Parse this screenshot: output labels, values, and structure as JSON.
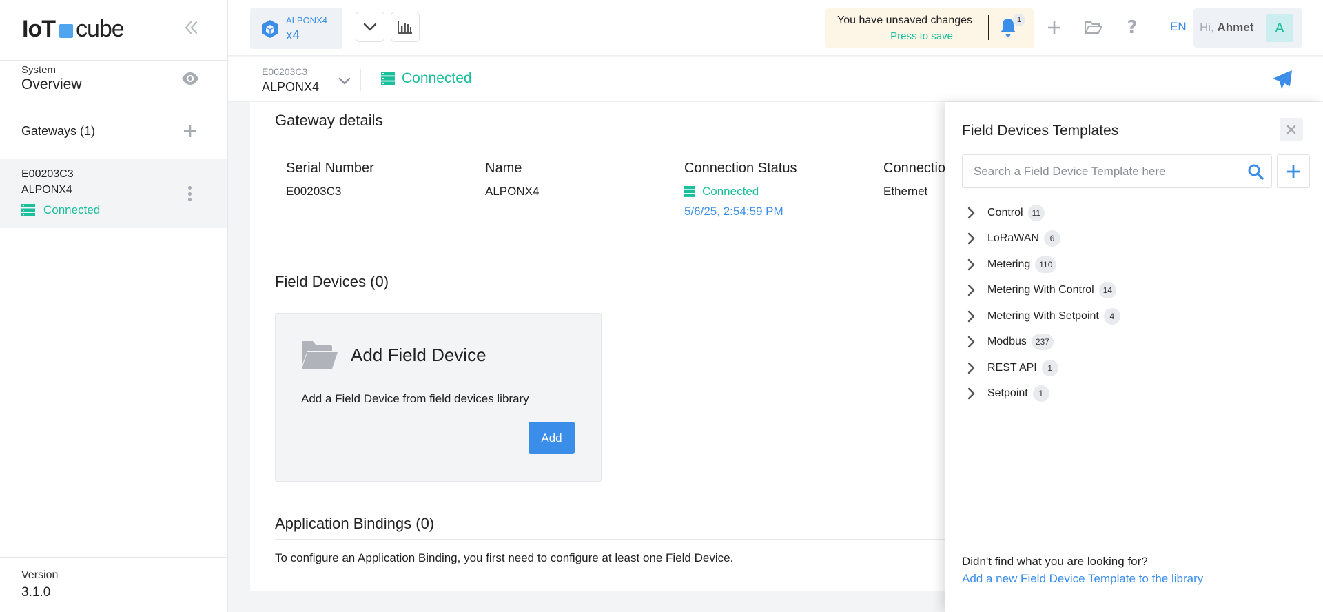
{
  "logo": {
    "part1": "IoT",
    "part2": "cube"
  },
  "sidebar": {
    "system_label": "System",
    "overview_title": "Overview",
    "gateways_title": "Gateways (1)",
    "gateway": {
      "serial": "E00203C3",
      "name": "ALPONX4",
      "status": "Connected"
    },
    "version_label": "Version",
    "version_value": "3.1.0"
  },
  "topbar": {
    "device_model": "ALPONX4",
    "device_count": "x4",
    "unsaved_message": "You have unsaved changes",
    "press_to_save": "Press to save",
    "notification_count": "1",
    "language": "EN",
    "greeting": "Hi,",
    "user_name": "Ahmet",
    "avatar_initial": "A"
  },
  "subbar": {
    "serial": "E00203C3",
    "name": "ALPONX4",
    "status": "Connected"
  },
  "gateway_details": {
    "title": "Gateway details",
    "columns": {
      "serial_header": "Serial Number",
      "serial_value": "E00203C3",
      "name_header": "Name",
      "name_value": "ALPONX4",
      "status_header": "Connection Status",
      "status_value": "Connected",
      "status_time": "5/6/25, 2:54:59 PM",
      "conn_header": "Connectio",
      "conn_value": "Ethernet"
    }
  },
  "field_devices": {
    "title": "Field Devices (0)",
    "card_title": "Add Field Device",
    "card_desc": "Add a Field Device from field devices library",
    "add_label": "Add"
  },
  "application_bindings": {
    "title": "Application Bindings (0)",
    "desc": "To configure an Application Binding, you first need to configure at least one Field Device."
  },
  "templates_panel": {
    "title": "Field Devices Templates",
    "search_placeholder": "Search a Field Device Template here",
    "categories": [
      {
        "label": "Control",
        "count": "11"
      },
      {
        "label": "LoRaWAN",
        "count": "6"
      },
      {
        "label": "Metering",
        "count": "110"
      },
      {
        "label": "Metering With Control",
        "count": "14"
      },
      {
        "label": "Metering With Setpoint",
        "count": "4"
      },
      {
        "label": "Modbus",
        "count": "237"
      },
      {
        "label": "REST API",
        "count": "1"
      },
      {
        "label": "Setpoint",
        "count": "1"
      }
    ],
    "not_found": "Didn't find what you are looking for?",
    "add_link": "Add a new Field Device Template to the library"
  },
  "colors": {
    "accent_blue": "#3a8de8",
    "connected_green": "#1bbf9c",
    "unsaved_bg": "#fdf5e6"
  },
  "icons": [
    "collapse-icon",
    "eye-icon",
    "plus-icon",
    "kebab-icon",
    "server-icon",
    "cube-icon",
    "chevron-down-icon",
    "bar-chart-icon",
    "bell-icon",
    "folder-open-icon",
    "help-icon",
    "send-icon",
    "folder-icon",
    "close-icon",
    "search-icon",
    "chevron-right-icon"
  ]
}
